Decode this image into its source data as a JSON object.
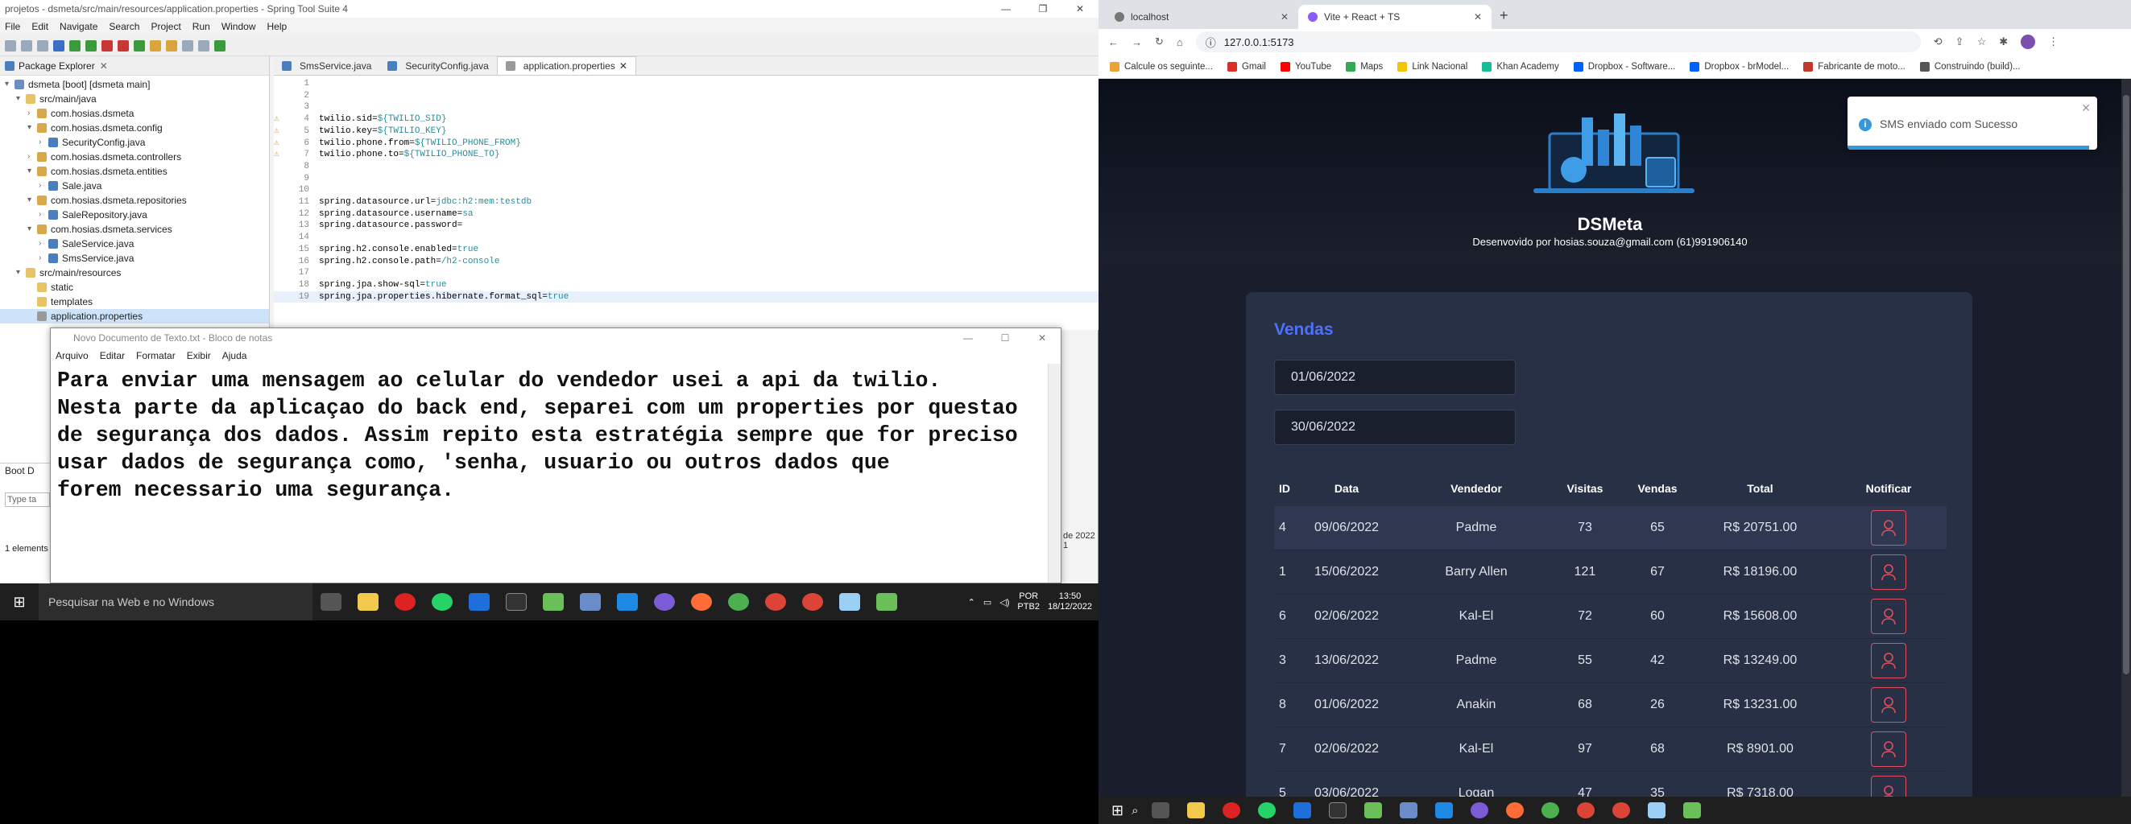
{
  "sts": {
    "title": "projetos - dsmeta/src/main/resources/application.properties - Spring Tool Suite 4",
    "menu": [
      "File",
      "Edit",
      "Navigate",
      "Search",
      "Project",
      "Run",
      "Window",
      "Help"
    ],
    "package_explorer": {
      "title": "Package Explorer",
      "items": [
        {
          "label": "dsmeta [boot] [dsmeta main]",
          "type": "proj",
          "indent": 0,
          "arrow": "▾"
        },
        {
          "label": "src/main/java",
          "type": "fold",
          "indent": 1,
          "arrow": "▾"
        },
        {
          "label": "com.hosias.dsmeta",
          "type": "pkg",
          "indent": 2,
          "arrow": "›"
        },
        {
          "label": "com.hosias.dsmeta.config",
          "type": "pkg",
          "indent": 2,
          "arrow": "▾"
        },
        {
          "label": "SecurityConfig.java",
          "type": "java",
          "indent": 3,
          "arrow": "›"
        },
        {
          "label": "com.hosias.dsmeta.controllers",
          "type": "pkg",
          "indent": 2,
          "arrow": "›"
        },
        {
          "label": "com.hosias.dsmeta.entities",
          "type": "pkg",
          "indent": 2,
          "arrow": "▾"
        },
        {
          "label": "Sale.java",
          "type": "java",
          "indent": 3,
          "arrow": "›"
        },
        {
          "label": "com.hosias.dsmeta.repositories",
          "type": "pkg",
          "indent": 2,
          "arrow": "▾"
        },
        {
          "label": "SaleRepository.java",
          "type": "java",
          "indent": 3,
          "arrow": "›"
        },
        {
          "label": "com.hosias.dsmeta.services",
          "type": "pkg",
          "indent": 2,
          "arrow": "▾"
        },
        {
          "label": "SaleService.java",
          "type": "java",
          "indent": 3,
          "arrow": "›"
        },
        {
          "label": "SmsService.java",
          "type": "java",
          "indent": 3,
          "arrow": "›"
        },
        {
          "label": "src/main/resources",
          "type": "fold",
          "indent": 1,
          "arrow": "▾"
        },
        {
          "label": "static",
          "type": "fold",
          "indent": 2,
          "arrow": ""
        },
        {
          "label": "templates",
          "type": "fold",
          "indent": 2,
          "arrow": ""
        },
        {
          "label": "application.properties",
          "type": "prop",
          "indent": 2,
          "arrow": "",
          "selected": true
        }
      ]
    },
    "boot_dash_label": "Boot D",
    "type_filter_placeholder": "Type ta",
    "elements_label": "1 elements",
    "status_date": "de 2022 1",
    "editor_tabs": [
      {
        "label": "SmsService.java",
        "active": false
      },
      {
        "label": "SecurityConfig.java",
        "active": false
      },
      {
        "label": "application.properties",
        "active": true
      }
    ],
    "code_lines": [
      {
        "n": "1",
        "key": "",
        "val": "",
        "w": false
      },
      {
        "n": "2",
        "key": "",
        "val": "",
        "w": false
      },
      {
        "n": "3",
        "key": "",
        "val": "",
        "w": false
      },
      {
        "n": "4",
        "key": "twilio.sid=",
        "val": "${TWILIO_SID}",
        "w": true
      },
      {
        "n": "5",
        "key": "twilio.key=",
        "val": "${TWILIO_KEY}",
        "w": true
      },
      {
        "n": "6",
        "key": "twilio.phone.from=",
        "val": "${TWILIO_PHONE_FROM}",
        "w": true
      },
      {
        "n": "7",
        "key": "twilio.phone.to=",
        "val": "${TWILIO_PHONE_TO}",
        "w": true
      },
      {
        "n": "8",
        "key": "",
        "val": "",
        "w": false
      },
      {
        "n": "9",
        "key": "",
        "val": "",
        "w": false
      },
      {
        "n": "10",
        "key": "",
        "val": "",
        "w": false
      },
      {
        "n": "11",
        "key": "spring.datasource.url=",
        "val": "jdbc:h2:mem:testdb",
        "w": false
      },
      {
        "n": "12",
        "key": "spring.datasource.username=",
        "val": "sa",
        "w": false
      },
      {
        "n": "13",
        "key": "spring.datasource.password=",
        "val": "",
        "w": false
      },
      {
        "n": "14",
        "key": "",
        "val": "",
        "w": false
      },
      {
        "n": "15",
        "key": "spring.h2.console.enabled=",
        "val": "true",
        "w": false
      },
      {
        "n": "16",
        "key": "spring.h2.console.path=",
        "val": "/h2-console",
        "w": false
      },
      {
        "n": "17",
        "key": "",
        "val": "",
        "w": false
      },
      {
        "n": "18",
        "key": "spring.jpa.show-sql=",
        "val": "true",
        "w": false
      },
      {
        "n": "19",
        "key": "spring.jpa.properties.hibernate.format_sql=",
        "val": "true",
        "w": false
      }
    ]
  },
  "notepad": {
    "title": "Novo Documento de Texto.txt - Bloco de notas",
    "menu": [
      "Arquivo",
      "Editar",
      "Formatar",
      "Exibir",
      "Ajuda"
    ],
    "text": "Para enviar uma mensagem ao celular do vendedor usei a api da twilio.\nNesta parte da aplicaçao do back end, separei com um properties por questao\nde segurança dos dados. Assim repito esta estratégia sempre que for preciso\nusar dados de segurança como, 'senha, usuario ou outros dados que\nforem necessario uma segurança."
  },
  "taskbar_left": {
    "search_placeholder": "Pesquisar na Web e no Windows",
    "lang1": "POR",
    "lang2": "PTB2",
    "time": "13:50",
    "date": "18/12/2022"
  },
  "chrome": {
    "tabs": [
      {
        "label": "localhost",
        "active": false
      },
      {
        "label": "Vite + React + TS",
        "active": true
      }
    ],
    "url": "127.0.0.1:5173",
    "bookmarks": [
      {
        "label": "Calcule os seguinte...",
        "color": "#e8a33a"
      },
      {
        "label": "Gmail",
        "color": "#d93025"
      },
      {
        "label": "YouTube",
        "color": "#ff0000"
      },
      {
        "label": "Maps",
        "color": "#34a853"
      },
      {
        "label": "Link Nacional",
        "color": "#f2c500"
      },
      {
        "label": "Khan Academy",
        "color": "#14bf96"
      },
      {
        "label": "Dropbox - Software...",
        "color": "#0061ff"
      },
      {
        "label": "Dropbox - brModel...",
        "color": "#0061ff"
      },
      {
        "label": "Fabricante de moto...",
        "color": "#c0392b"
      },
      {
        "label": "Construindo (build)...",
        "color": "#555555"
      }
    ]
  },
  "app": {
    "brand": "DSMeta",
    "credit": "Desenvovido por hosias.souza@gmail.com (61)991906140",
    "toast": "SMS enviado com Sucesso",
    "card_title": "Vendas",
    "date_min": "01/06/2022",
    "date_max": "30/06/2022",
    "columns": [
      "ID",
      "Data",
      "Vendedor",
      "Visitas",
      "Vendas",
      "Total",
      "Notificar"
    ],
    "rows": [
      {
        "id": "4",
        "date": "09/06/2022",
        "seller": "Padme",
        "visits": "73",
        "sales": "65",
        "total": "R$ 20751.00"
      },
      {
        "id": "1",
        "date": "15/06/2022",
        "seller": "Barry Allen",
        "visits": "121",
        "sales": "67",
        "total": "R$ 18196.00"
      },
      {
        "id": "6",
        "date": "02/06/2022",
        "seller": "Kal-El",
        "visits": "72",
        "sales": "60",
        "total": "R$ 15608.00"
      },
      {
        "id": "3",
        "date": "13/06/2022",
        "seller": "Padme",
        "visits": "55",
        "sales": "42",
        "total": "R$ 13249.00"
      },
      {
        "id": "8",
        "date": "01/06/2022",
        "seller": "Anakin",
        "visits": "68",
        "sales": "26",
        "total": "R$ 13231.00"
      },
      {
        "id": "7",
        "date": "02/06/2022",
        "seller": "Kal-El",
        "visits": "97",
        "sales": "68",
        "total": "R$ 8901.00"
      },
      {
        "id": "5",
        "date": "03/06/2022",
        "seller": "Logan",
        "visits": "47",
        "sales": "35",
        "total": "R$ 7318.00"
      }
    ],
    "colors": {
      "accent": "#4d71ff",
      "notify": "#e34f5f",
      "card": "#283045",
      "bg": "#1a1d2b"
    }
  }
}
